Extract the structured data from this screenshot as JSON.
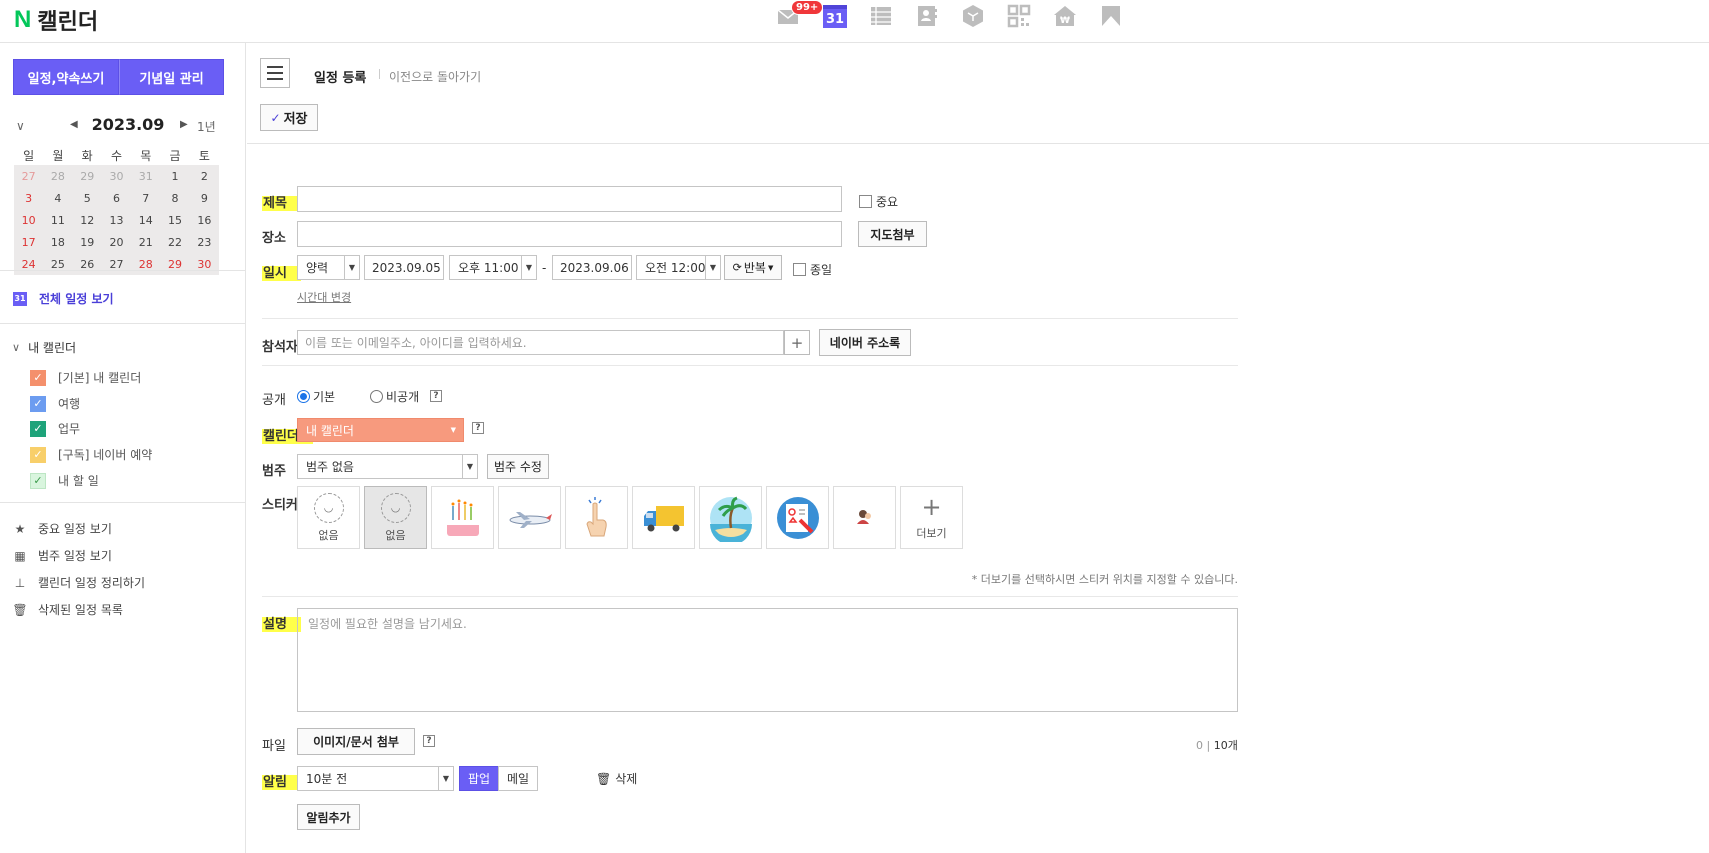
{
  "header": {
    "logo_n": "N",
    "logo_text": "캘린더",
    "mail_badge": "99+",
    "calendar_icon_day": "31",
    "icons": [
      "mail-icon",
      "calendar-icon",
      "list-icon",
      "contacts-icon",
      "box-icon",
      "qr-icon",
      "pay-icon",
      "bookmark-icon"
    ]
  },
  "sidebar": {
    "write_button": "일정,약속쓰기",
    "anniversary_button": "기념일 관리",
    "mini_calendar": {
      "month": "2023.09",
      "year_view": "1년",
      "weekdays": [
        "일",
        "월",
        "화",
        "수",
        "목",
        "금",
        "토"
      ],
      "weeks": [
        [
          "27",
          "28",
          "29",
          "30",
          "31",
          "1",
          "2"
        ],
        [
          "3",
          "4",
          "5",
          "6",
          "7",
          "8",
          "9"
        ],
        [
          "10",
          "11",
          "12",
          "13",
          "14",
          "15",
          "16"
        ],
        [
          "17",
          "18",
          "19",
          "20",
          "21",
          "22",
          "23"
        ],
        [
          "24",
          "25",
          "26",
          "27",
          "28",
          "29",
          "30"
        ]
      ]
    },
    "all_view": "전체 일정 보기",
    "all_view_icon": "31",
    "my_calendar_header": "내 캘린더",
    "calendars": [
      {
        "label": "[기본] 내 캘린더",
        "color": "#f4906c"
      },
      {
        "label": "여행",
        "color": "#6c9cf0"
      },
      {
        "label": "업무",
        "color": "#1ea37a"
      },
      {
        "label": "[구독] 네이버 예약",
        "color": "#f8cf6a"
      },
      {
        "label": "내 할 일",
        "color": "#d9f5de"
      }
    ],
    "links": [
      {
        "label": "중요 일정 보기",
        "icon": "star-icon"
      },
      {
        "label": "범주 일정 보기",
        "icon": "category-icon"
      },
      {
        "label": "캘린더 일정 정리하기",
        "icon": "stamp-icon"
      },
      {
        "label": "삭제된 일정 목록",
        "icon": "trash-icon"
      }
    ]
  },
  "main": {
    "page_title": "일정 등록",
    "back_link": "이전으로 돌아가기",
    "save_button": "저장",
    "title_label": "제목",
    "title_value": "",
    "important_label": "중요",
    "place_label": "장소",
    "place_value": "",
    "map_button": "지도첨부",
    "datetime_label": "일시",
    "calendar_type": "양력",
    "start_date": "2023.09.05",
    "start_time": "오후 11:00",
    "dash": "-",
    "end_date": "2023.09.06",
    "end_time": "오전 12:00",
    "repeat_button": "반복",
    "allday_label": "종일",
    "timezone_link": "시간대 변경",
    "attendee_label": "참석자",
    "attendee_placeholder": "이름 또는 이메일주소, 아이디를 입력하세요.",
    "attendee_add": "+",
    "address_book_button": "네이버 주소록",
    "visibility_label": "공개",
    "visibility_options": [
      "기본",
      "비공개"
    ],
    "visibility_selected": "기본",
    "calendar_label": "캘린더",
    "calendar_value": "내 캘린더",
    "calendar_color": "#f79a7e",
    "category_label": "범주",
    "category_value": "범주 없음",
    "category_edit_button": "범주 수정",
    "sticker_label": "스티커",
    "stickers": [
      "없음",
      "없음",
      "cake",
      "airplane",
      "hand",
      "truck",
      "beach",
      "document",
      "person"
    ],
    "sticker_more": "더보기",
    "sticker_note": "* 더보기를 선택하시면 스티커 위치를 지정할 수 있습니다.",
    "desc_label": "설명",
    "desc_placeholder": "일정에 필요한 설명을 남기세요.",
    "file_label": "파일",
    "attach_button": "이미지/문서 첨부",
    "file_count": "0",
    "file_max": "10개",
    "alarm_label": "알림",
    "alarm_value": "10분 전",
    "alarm_popup": "팝업",
    "alarm_mail": "메일",
    "alarm_delete": "삭제",
    "alarm_add_button": "알림추가",
    "help": "?",
    "highlight_color": "#ffff4a",
    "accent_color": "#6a5ef5"
  }
}
